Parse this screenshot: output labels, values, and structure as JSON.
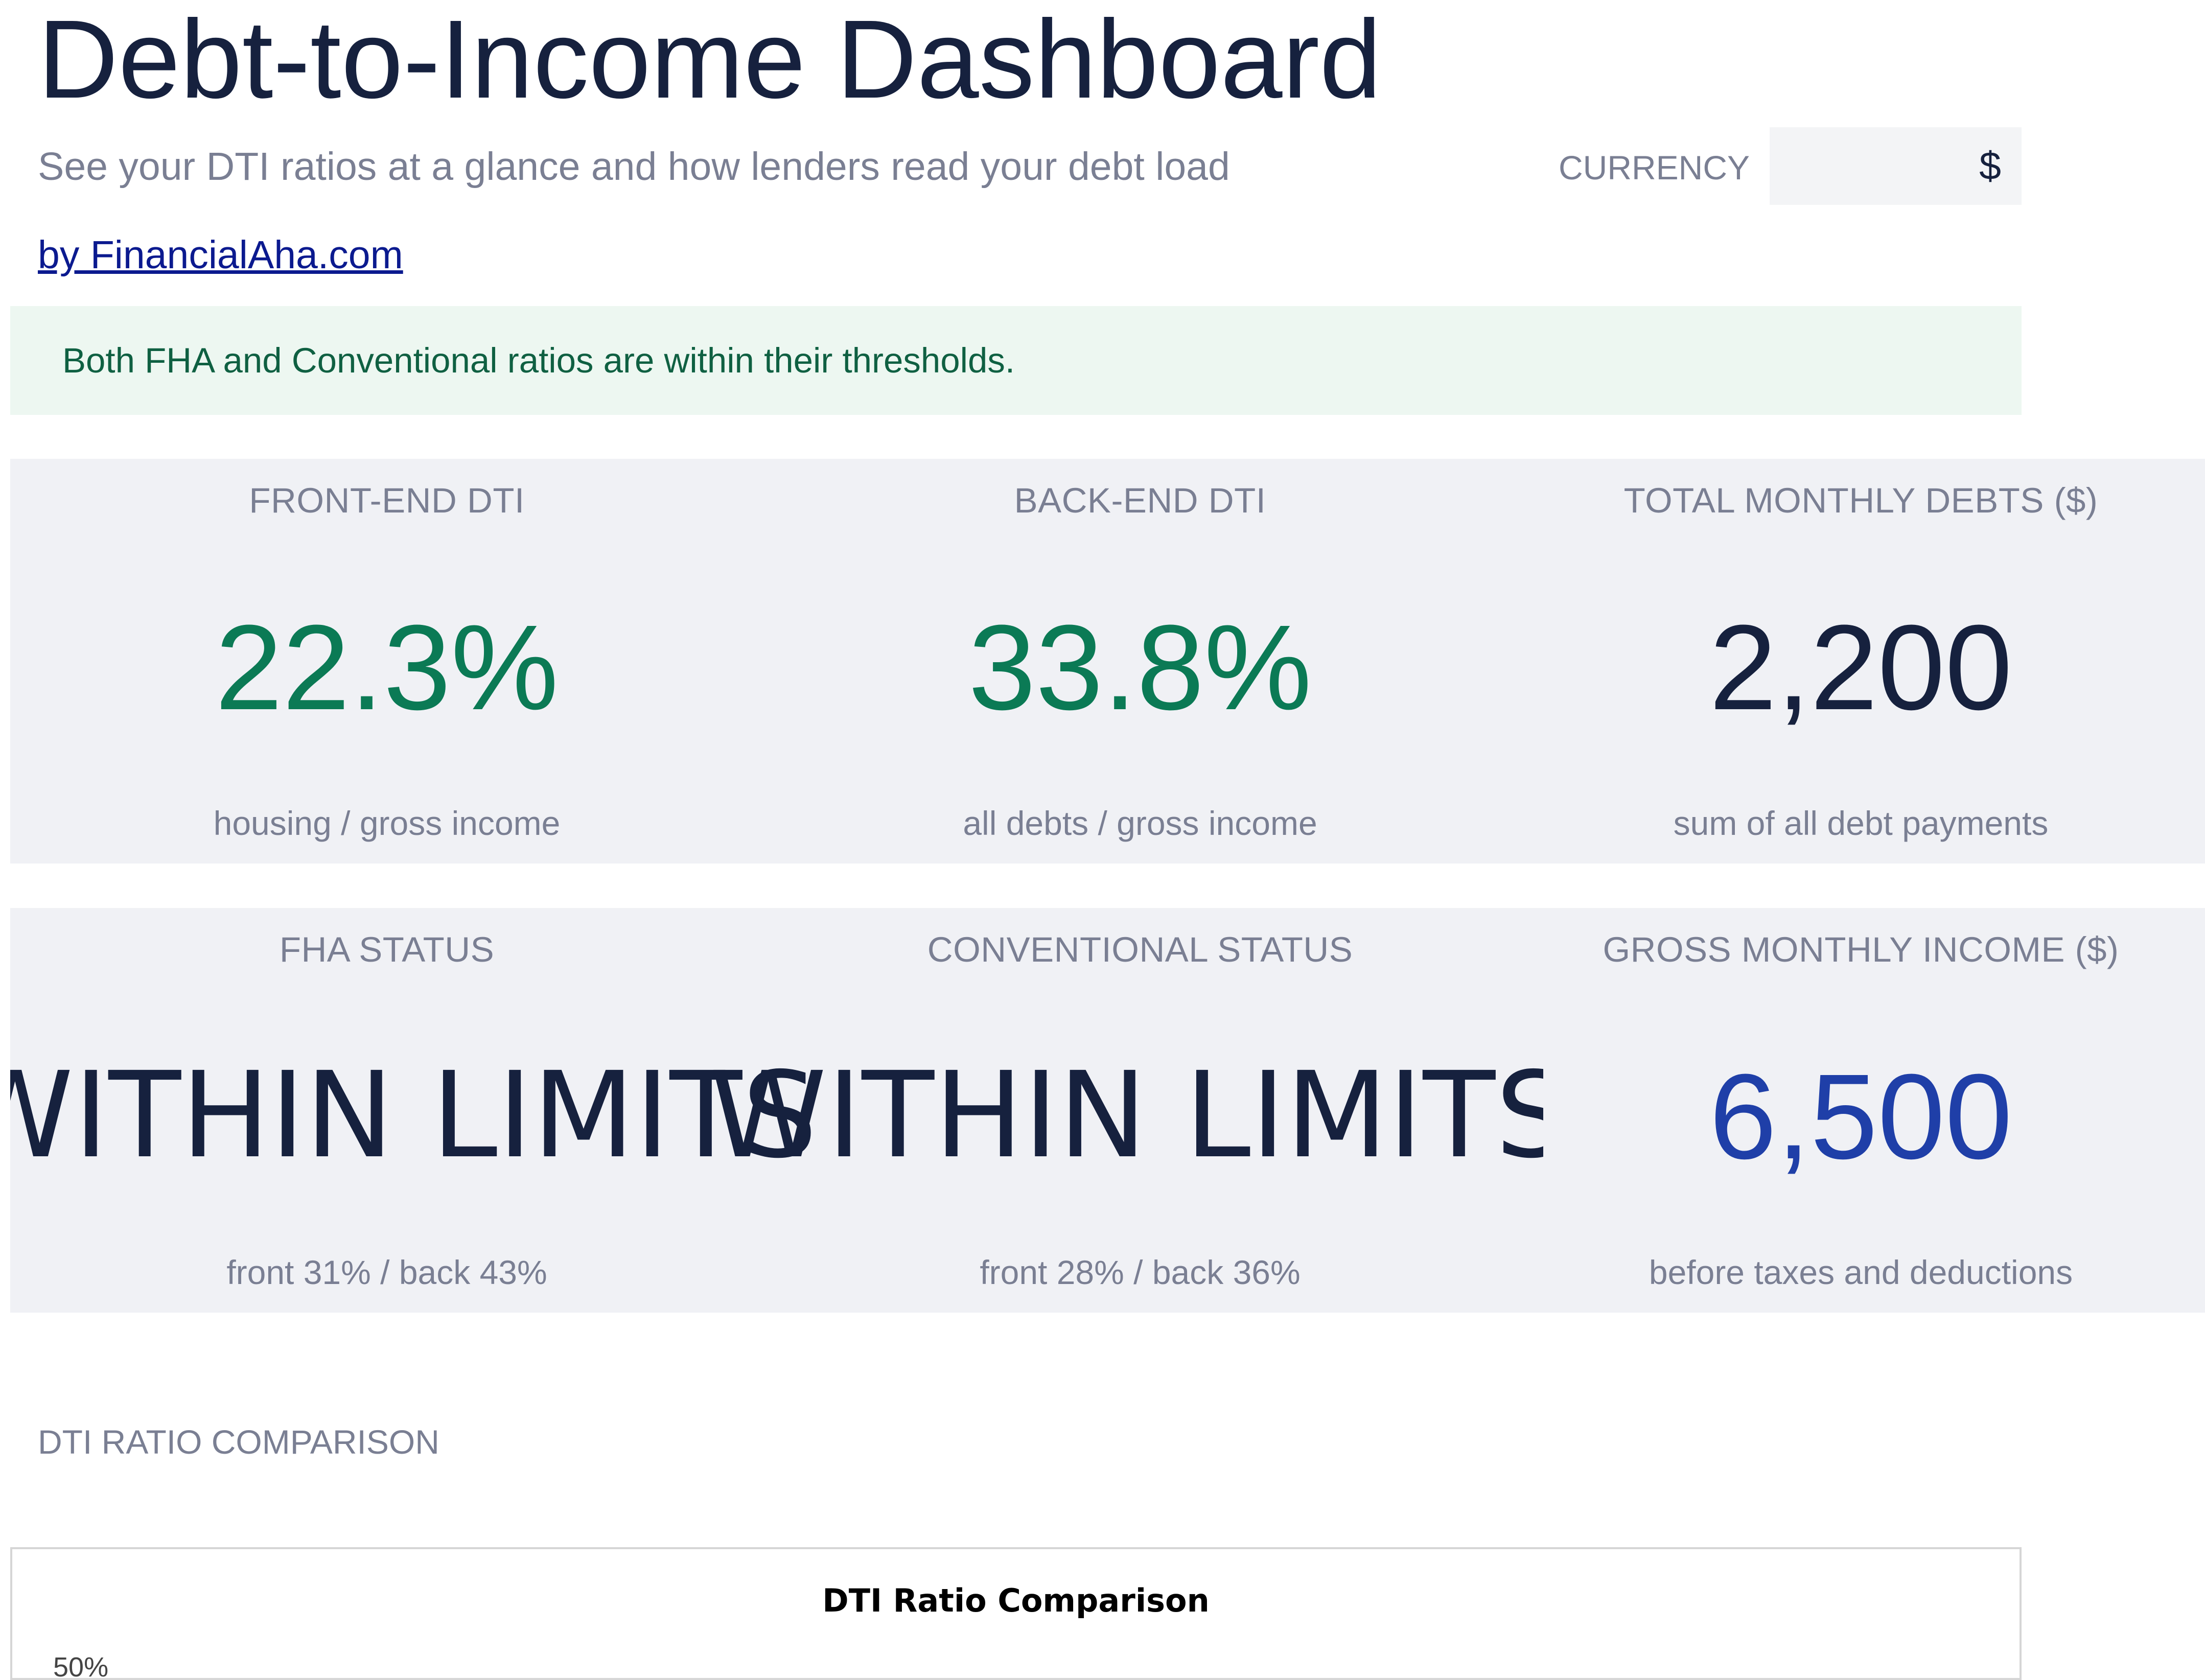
{
  "header": {
    "title": "Debt-to-Income Dashboard",
    "subtitle": "See your DTI ratios at a glance and how lenders read your debt load",
    "byline": "by FinancialAha.com",
    "currency_label": "CURRENCY",
    "currency_value": "$"
  },
  "banner": {
    "message": "Both FHA and Conventional ratios are within their thresholds."
  },
  "kpis": {
    "front_end": {
      "label": "FRONT-END DTI",
      "value": "22.3%",
      "sub": "housing / gross income"
    },
    "back_end": {
      "label": "BACK-END DTI",
      "value": "33.8%",
      "sub": "all debts / gross income"
    },
    "total_debts": {
      "label": "TOTAL MONTHLY DEBTS ($)",
      "value": "2,200",
      "sub": "sum of all debt payments"
    },
    "fha": {
      "label": "FHA STATUS",
      "value": "WITHIN LIMITS",
      "sub": "front 31% / back 43%"
    },
    "conventional": {
      "label": "CONVENTIONAL STATUS",
      "value": "WITHIN LIMITS",
      "sub": "front 28% / back 36%"
    },
    "income": {
      "label": "GROSS MONTHLY INCOME ($)",
      "value": "6,500",
      "sub": "before taxes and deductions"
    }
  },
  "colors": {
    "ok_green": "#0b7a55",
    "navy": "#16213e",
    "income_blue": "#1f3fa8",
    "banner_bg": "#edf7f1",
    "card_bg": "#f0f1f5"
  },
  "section": {
    "chart_label": "DTI RATIO COMPARISON"
  },
  "chart": {
    "title": "DTI Ratio Comparison",
    "y_top_tick": "50%"
  }
}
